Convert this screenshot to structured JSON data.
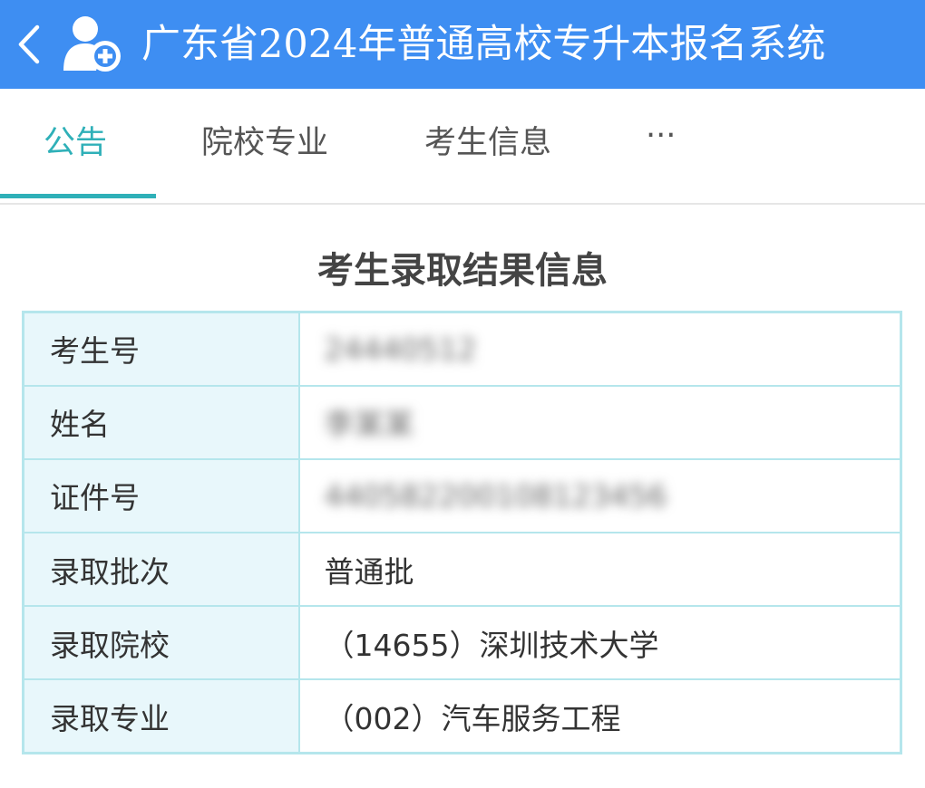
{
  "header": {
    "title": "广东省2024年普通高校专升本报名系统",
    "back_icon": "chevron-left-icon",
    "logo_icon": "user-add-icon",
    "background_color": "#3e8ef2"
  },
  "tabs": [
    {
      "label": "公告",
      "active": true
    },
    {
      "label": "院校专业",
      "active": false
    },
    {
      "label": "考生信息",
      "active": false
    },
    {
      "label": "···",
      "active": false
    }
  ],
  "accent_color": "#2fb0b8",
  "section": {
    "title": "考生录取结果信息"
  },
  "table": {
    "rows": [
      {
        "label": "考生号",
        "value": "24440512",
        "blurred": true
      },
      {
        "label": "姓名",
        "value": "李某某",
        "blurred": true
      },
      {
        "label": "证件号",
        "value": "440582200108123456",
        "blurred": true
      },
      {
        "label": "录取批次",
        "value": "普通批",
        "blurred": false
      },
      {
        "label": "录取院校",
        "value": "（14655）深圳技术大学",
        "blurred": false
      },
      {
        "label": "录取专业",
        "value": "（002）汽车服务工程",
        "blurred": false
      }
    ]
  }
}
